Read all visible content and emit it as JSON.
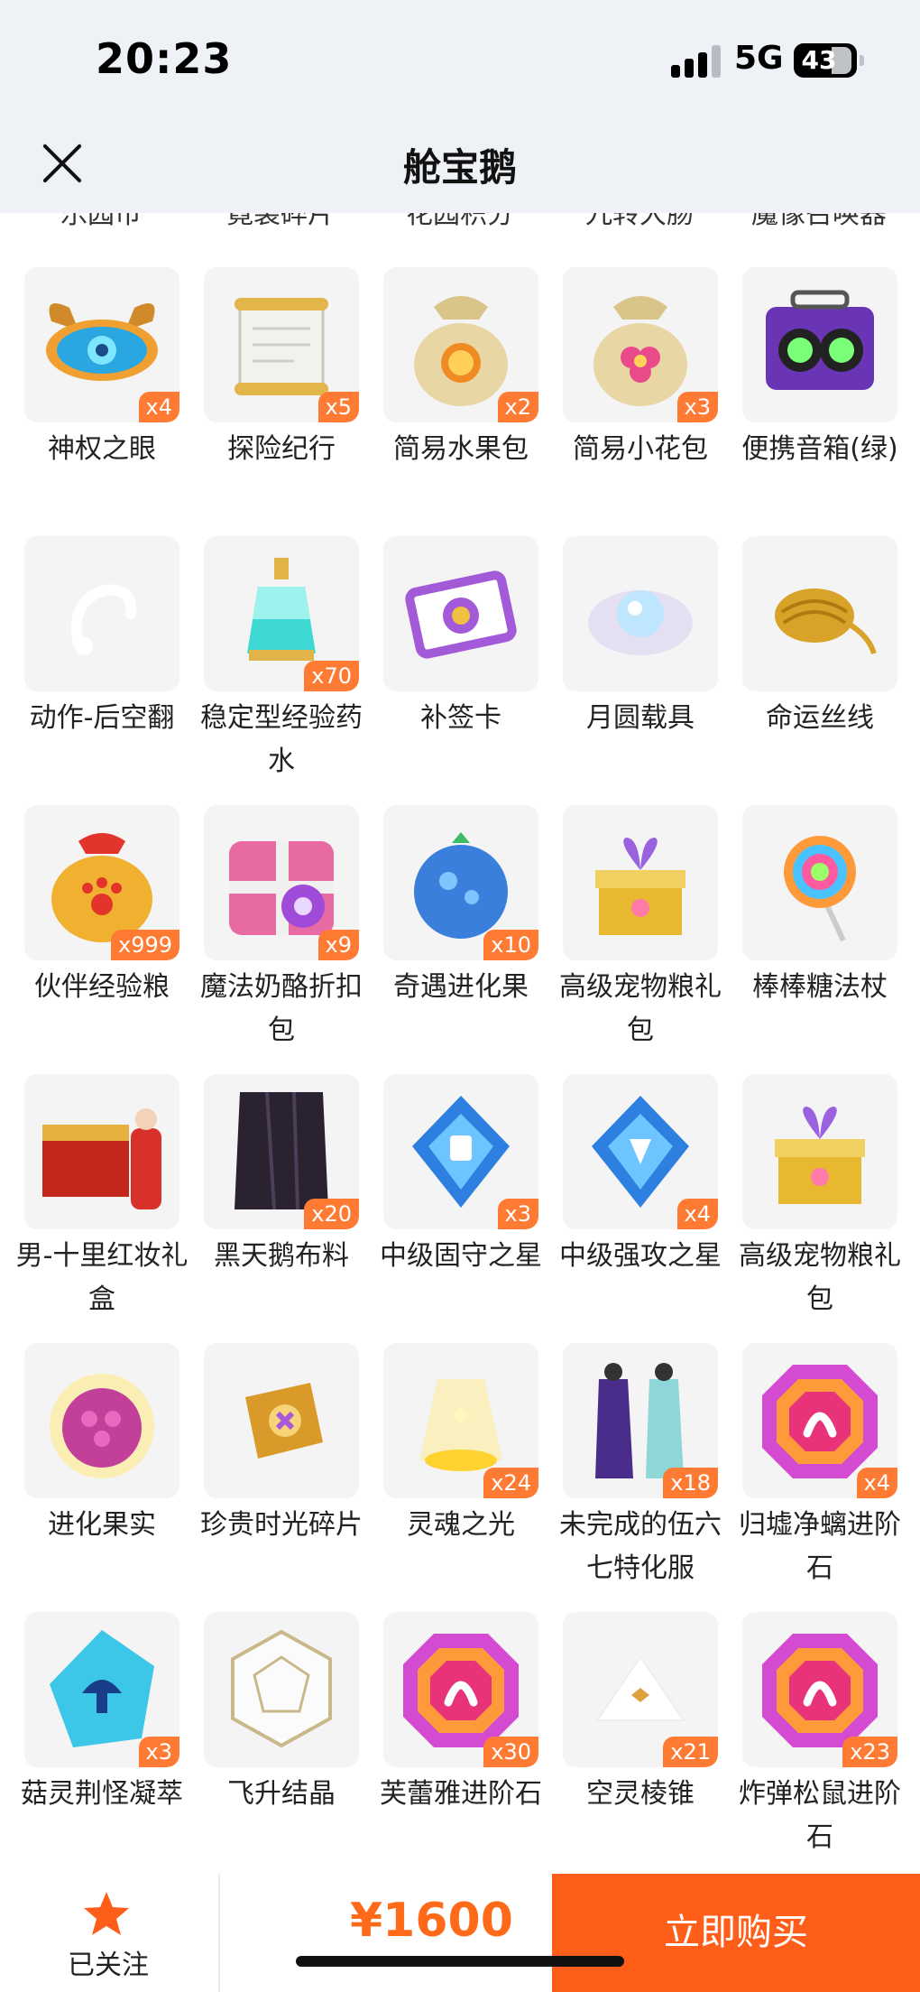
{
  "status_bar": {
    "time": "20:23",
    "network": "5G",
    "battery": "43"
  },
  "header": {
    "title": "舱宝鹅"
  },
  "cutoff_labels": [
    "乐园币",
    "霓裳碎片",
    "花园积分",
    "九转大肠",
    "魔像召唤器"
  ],
  "items": [
    {
      "name": "神权之眼",
      "count": "x4",
      "icon": "eye-crest-icon"
    },
    {
      "name": "探险纪行",
      "count": "x5",
      "icon": "scroll-icon"
    },
    {
      "name": "简易水果包",
      "count": "x2",
      "icon": "fruit-bag-icon"
    },
    {
      "name": "简易小花包",
      "count": "x3",
      "icon": "flower-bag-icon"
    },
    {
      "name": "便携音箱(绿)",
      "count": "",
      "icon": "speaker-icon"
    },
    {
      "name": "动作-后空翻",
      "count": "",
      "icon": "backflip-action-icon"
    },
    {
      "name": "稳定型经验药水",
      "count": "x70",
      "icon": "potion-icon"
    },
    {
      "name": "补签卡",
      "count": "",
      "icon": "ticket-icon"
    },
    {
      "name": "月圆载具",
      "count": "",
      "icon": "moon-vehicle-icon"
    },
    {
      "name": "命运丝线",
      "count": "",
      "icon": "golden-thread-icon"
    },
    {
      "name": "伙伴经验粮",
      "count": "x999",
      "icon": "paw-bag-icon"
    },
    {
      "name": "魔法奶酪折扣包",
      "count": "x9",
      "icon": "gift-box-icon"
    },
    {
      "name": "奇遇进化果",
      "count": "x10",
      "icon": "blue-fruit-icon"
    },
    {
      "name": "高级宠物粮礼包",
      "count": "",
      "icon": "pet-food-gift-icon"
    },
    {
      "name": "棒棒糖法杖",
      "count": "",
      "icon": "lollipop-icon"
    },
    {
      "name": "男-十里红妆礼盒",
      "count": "",
      "icon": "wedding-chest-icon"
    },
    {
      "name": "黑天鹅布料",
      "count": "x20",
      "icon": "black-cloth-icon"
    },
    {
      "name": "中级固守之星",
      "count": "x3",
      "icon": "shield-star-icon"
    },
    {
      "name": "中级强攻之星",
      "count": "x4",
      "icon": "attack-star-icon"
    },
    {
      "name": "高级宠物粮礼包",
      "count": "",
      "icon": "pet-food-gift-icon"
    },
    {
      "name": "进化果实",
      "count": "",
      "icon": "raspberry-icon"
    },
    {
      "name": "珍贵时光碎片",
      "count": "",
      "icon": "time-shard-icon"
    },
    {
      "name": "灵魂之光",
      "count": "x24",
      "icon": "soul-light-icon"
    },
    {
      "name": "未完成的伍六七特化服",
      "count": "x18",
      "icon": "outfit-icon"
    },
    {
      "name": "归墟净螭进阶石",
      "count": "x4",
      "icon": "advance-stone-icon"
    },
    {
      "name": "菇灵荆怪凝萃",
      "count": "x3",
      "icon": "mushroom-crystal-icon"
    },
    {
      "name": "飞升结晶",
      "count": "",
      "icon": "ascension-crystal-icon"
    },
    {
      "name": "芙蕾雅进阶石",
      "count": "x30",
      "icon": "advance-stone-icon"
    },
    {
      "name": "空灵棱锥",
      "count": "x21",
      "icon": "pyramid-icon"
    },
    {
      "name": "炸弹松鼠进阶石",
      "count": "x23",
      "icon": "advance-stone-icon"
    }
  ],
  "footer": {
    "follow_label": "已关注",
    "price": "¥1600",
    "buy_label": "立即购买"
  },
  "colors": {
    "accent": "#ff5e1a",
    "badge": "#ff7a33",
    "header_bg": "#eef2f6"
  }
}
